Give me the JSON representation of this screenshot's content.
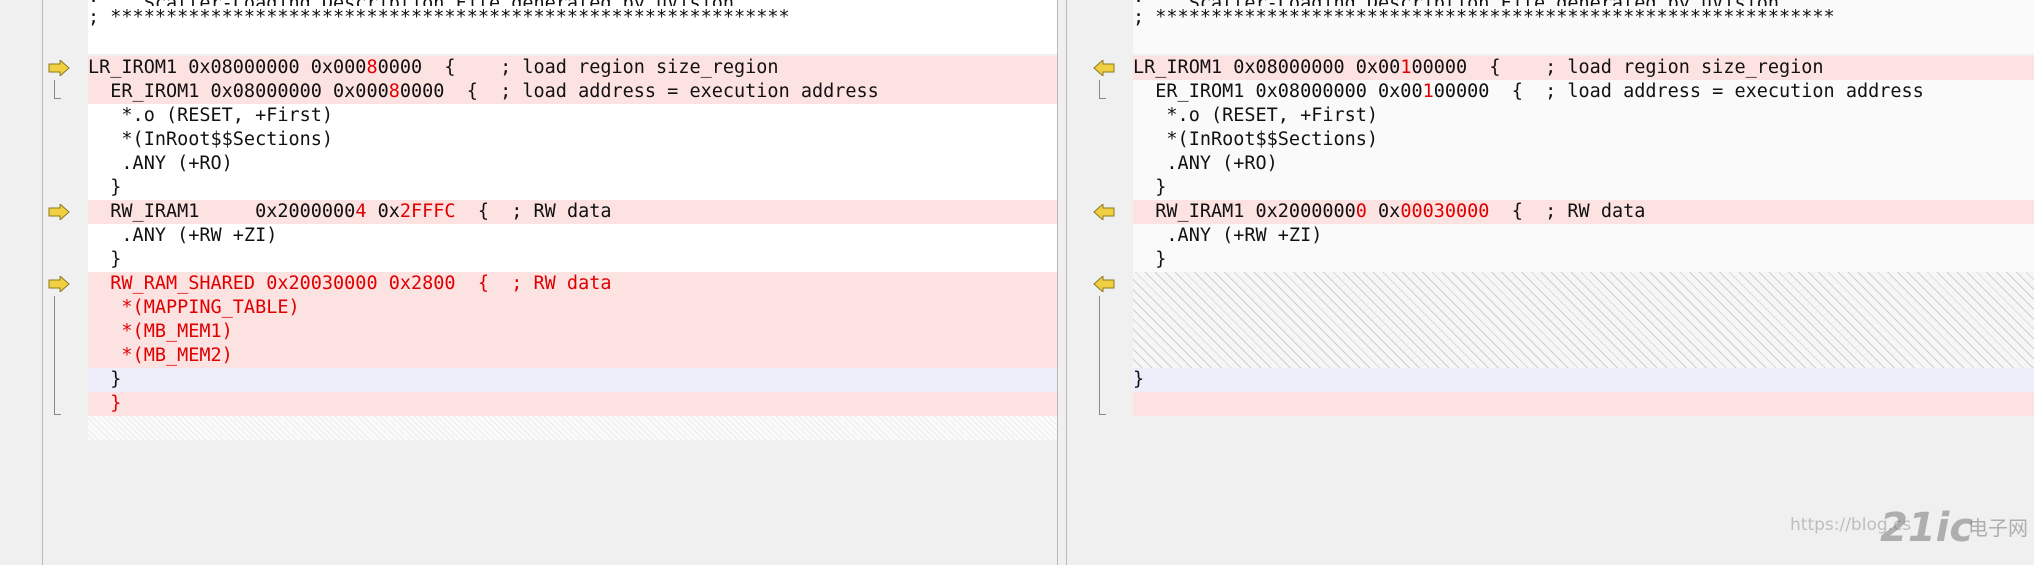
{
  "left": {
    "header1": ";    Scatter-Loading Description File generated by uVision",
    "header2": "; *************************************************************",
    "lr_pre": "LR_IROM1 0x08000000 0x000",
    "lr_red": "8",
    "lr_post": "0000  {    ; load region size_region",
    "er_pre": "  ER_IROM1 0x08000000 0x000",
    "er_red": "8",
    "er_post": "0000  {  ; load address = execution address",
    "o_line": "   *.o (RESET, +First)",
    "inroot": "   *(InRoot$$Sections)",
    "any_ro": "   .ANY (+RO)",
    "brace1": "  }",
    "rw_pre": "  RW_IRAM1     0x2000000",
    "rw_red1": "4",
    "rw_mid": " 0x",
    "rw_red2": "2FFFC",
    "rw_post": "  {  ; RW data",
    "any_rw": "   .ANY (+RW +ZI)",
    "brace2": "  }",
    "shared": "  RW_RAM_SHARED 0x20030000 0x2800  {  ; RW data",
    "map": "   *(MAPPING_TABLE)",
    "mem1": "   *(MB_MEM1)",
    "mem2": "   *(MB_MEM2)",
    "brace3": "  }",
    "brace4": "  }"
  },
  "right": {
    "header1": ";    Scatter-Loading Description File generated by uVision",
    "header2": "; *************************************************************",
    "lr_pre": "LR_IROM1 0x08000000 0x00",
    "lr_red": "1",
    "lr_post": "00000  {    ; load region size_region",
    "er_pre": "  ER_IROM1 0x08000000 0x00",
    "er_red": "1",
    "er_post": "00000  {  ; load address = execution address",
    "o_line": "   *.o (RESET, +First)",
    "inroot": "   *(InRoot$$Sections)",
    "any_ro": "   .ANY (+RO)",
    "brace1": "  }",
    "rw_pre": "  RW_IRAM1 0x2000000",
    "rw_red1": "0",
    "rw_mid": " 0x",
    "rw_red2": "00030000",
    "rw_post": "  {  ; RW data",
    "any_rw": "   .ANY (+RW +ZI)",
    "brace2": "  }",
    "brace3": "}"
  },
  "watermark": {
    "url": "https://blog.cs",
    "logo": "21ic",
    "cn": "电子网"
  },
  "colors": {
    "diff_red": "#e00000",
    "change_bg": "#fde2e2",
    "added_bg": "#eeeefb",
    "arrow": "#f0d040"
  }
}
